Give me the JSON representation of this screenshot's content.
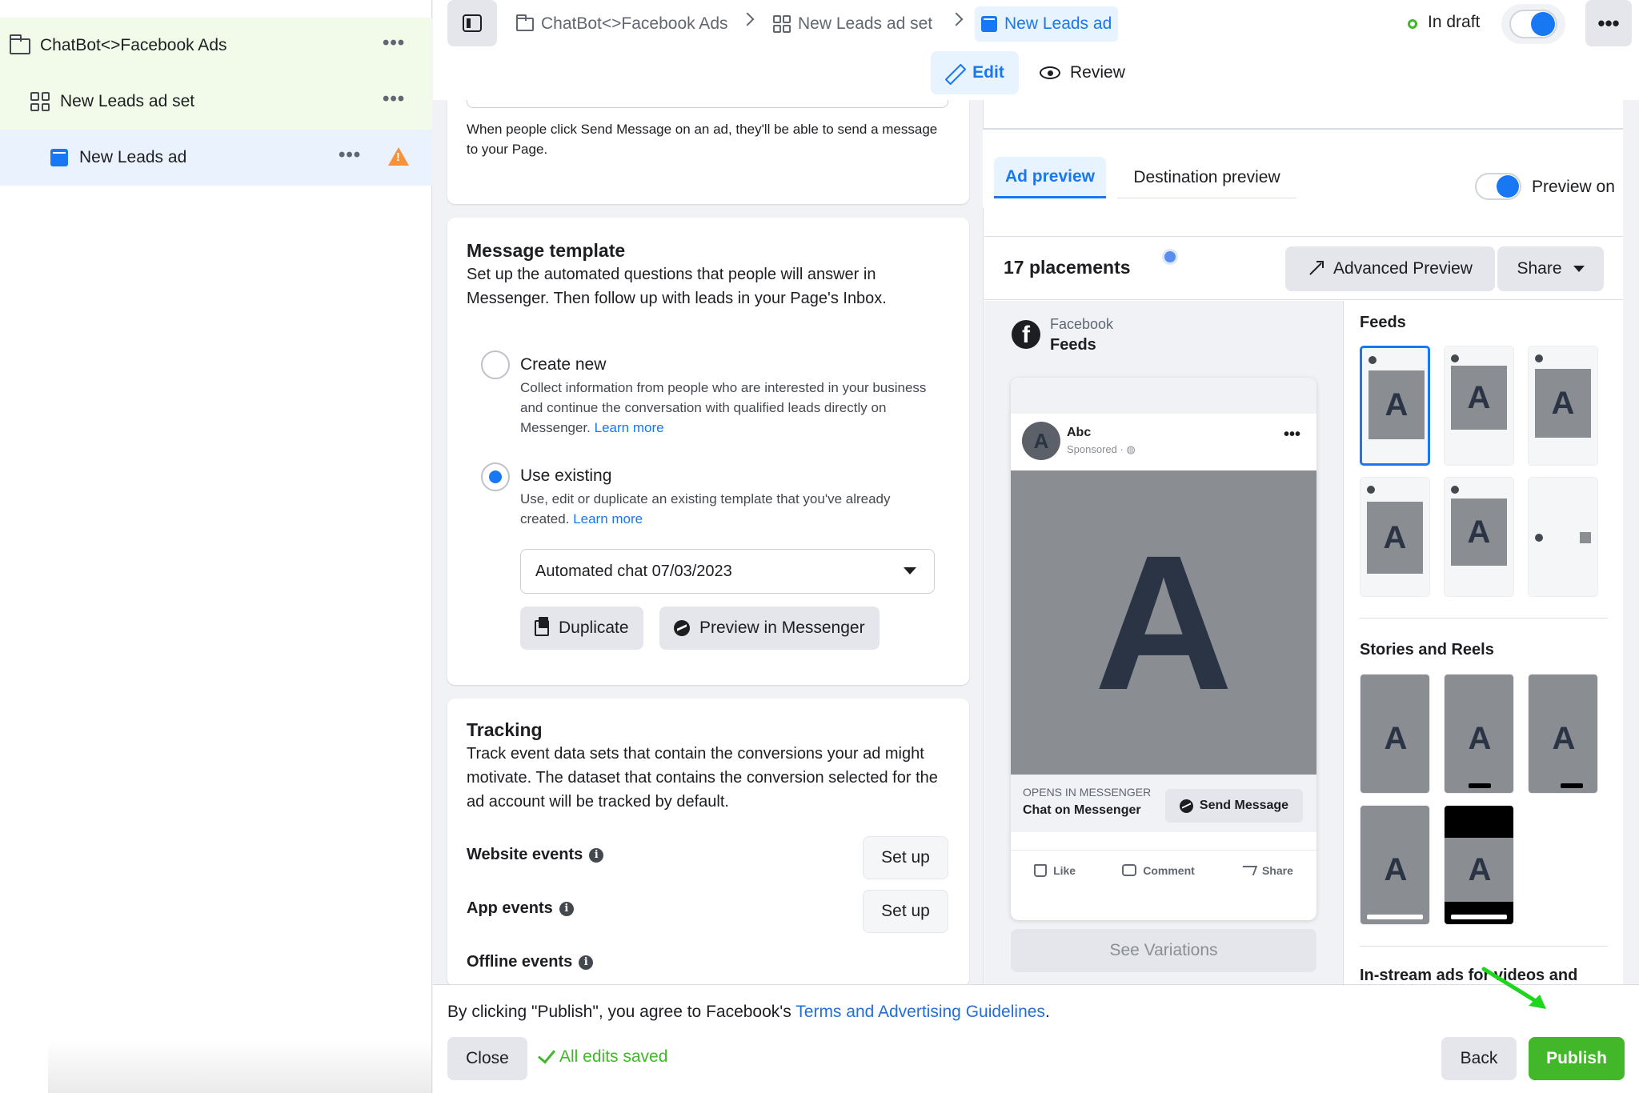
{
  "sidebar": {
    "items": [
      {
        "label": "ChatBot<>Facebook Ads",
        "icon": "folder-icon"
      },
      {
        "label": "New Leads ad set",
        "icon": "grid-icon"
      },
      {
        "label": "New Leads ad",
        "icon": "ad-icon",
        "warning": "warning-icon"
      }
    ],
    "more_label": "•••"
  },
  "header": {
    "breadcrumbs": [
      {
        "label": "ChatBot<>Facebook Ads"
      },
      {
        "label": "New Leads ad set"
      },
      {
        "label": "New Leads ad"
      }
    ],
    "status": "In draft",
    "more_label": "•••",
    "tabs": {
      "edit": "Edit",
      "review": "Review"
    }
  },
  "form": {
    "send_message_help": "When people click Send Message on an ad, they'll be able to send a message to your Page.",
    "message_template": {
      "title": "Message template",
      "description": "Set up the automated questions that people will answer in Messenger. Then follow up with leads in your Page's Inbox.",
      "options": [
        {
          "title": "Create new",
          "description": "Collect information from people who are interested in your business and continue the conversation with qualified leads directly on Messenger.",
          "link": "Learn more",
          "selected": false
        },
        {
          "title": "Use existing",
          "description": "Use, edit or duplicate an existing template that you've already created.",
          "link": "Learn more",
          "selected": true
        }
      ],
      "selected_template": "Automated chat 07/03/2023",
      "duplicate_label": "Duplicate",
      "preview_messenger_label": "Preview in Messenger"
    },
    "tracking": {
      "title": "Tracking",
      "description": "Track event data sets that contain the conversions your ad might motivate. The dataset that contains the conversion selected for the ad account will be tracked by default.",
      "events": [
        {
          "label": "Website events",
          "button": "Set up"
        },
        {
          "label": "App events",
          "button": "Set up"
        },
        {
          "label": "Offline events"
        }
      ]
    }
  },
  "preview": {
    "tabs": {
      "ad_preview": "Ad preview",
      "destination_preview": "Destination preview"
    },
    "preview_toggle_label": "Preview on",
    "placements_count": "17 placements",
    "advanced_preview_label": "Advanced Preview",
    "share_label": "Share",
    "platform": "Facebook",
    "position": "Feeds",
    "mock_ad": {
      "page_name": "Abc",
      "sponsored": "Sponsored · ◍",
      "avatar_letter": "A",
      "image_letter": "A",
      "opens_in": "OPENS IN MESSENGER",
      "headline": "Chat on Messenger",
      "cta": "Send Message",
      "actions": [
        "Like",
        "Comment",
        "Share"
      ]
    },
    "see_variations_label": "See Variations",
    "placement_groups": [
      {
        "heading": "Feeds"
      },
      {
        "heading": "Stories and Reels"
      },
      {
        "heading": "In-stream ads for videos and"
      }
    ],
    "thumb_letter": "A"
  },
  "footer": {
    "terms_prefix": "By clicking \"Publish\", you agree to Facebook's ",
    "terms_link": "Terms and Advertising Guidelines",
    "terms_suffix": ".",
    "close_label": "Close",
    "saved_label": "All edits saved",
    "back_label": "Back",
    "publish_label": "Publish"
  },
  "colors": {
    "accent": "#1877f2",
    "publish": "#42b72a",
    "warning": "#f7923b"
  }
}
